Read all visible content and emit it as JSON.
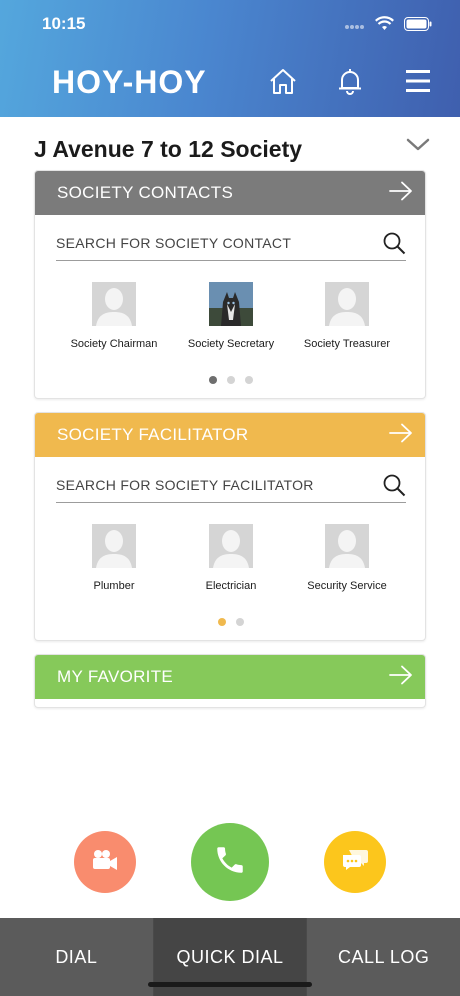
{
  "status": {
    "time": "10:15"
  },
  "header": {
    "title": "HOY-HOY"
  },
  "society": {
    "name": "J Avenue 7 to 12 Society"
  },
  "contacts": {
    "heading": "SOCIETY CONTACTS",
    "color": "#7b7b7b",
    "search_placeholder": "SEARCH FOR SOCIETY CONTACT",
    "people": [
      {
        "label": "Society Chairman"
      },
      {
        "label": "Society Secretary"
      },
      {
        "label": "Society Treasurer"
      }
    ],
    "page": 1,
    "pages": 3
  },
  "facilitator": {
    "heading": "SOCIETY FACILITATOR",
    "color": "#f0b94e",
    "search_placeholder": "SEARCH FOR SOCIETY FACILITATOR",
    "people": [
      {
        "label": "Plumber"
      },
      {
        "label": "Electrician"
      },
      {
        "label": "Security Service"
      }
    ],
    "page": 1,
    "pages": 2
  },
  "favorite": {
    "heading": "MY FAVORITE",
    "color": "#86c95a"
  },
  "actions": {
    "video_color": "#f98c6e",
    "call_color": "#75c653",
    "chat_color": "#fcc61c"
  },
  "tabs": [
    {
      "label": "DIAL"
    },
    {
      "label": "QUICK DIAL"
    },
    {
      "label": "CALL LOG"
    }
  ]
}
